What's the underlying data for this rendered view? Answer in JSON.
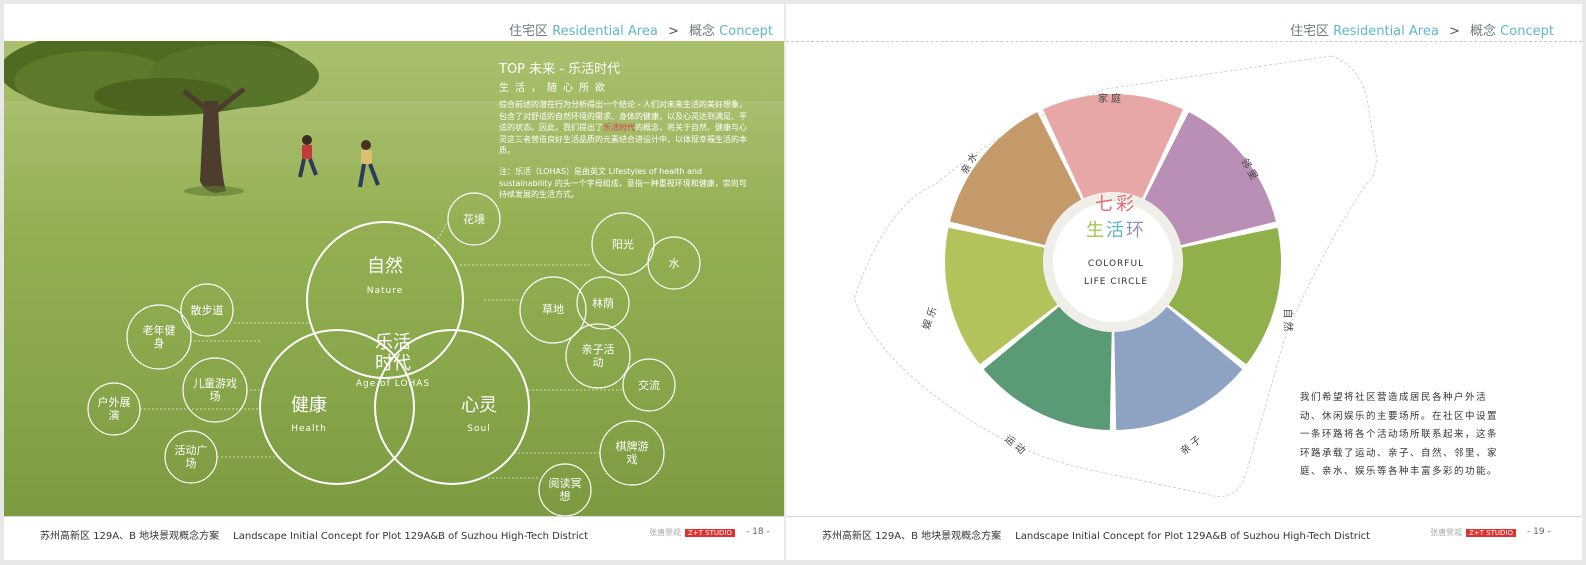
{
  "left_page": {
    "breadcrumb": {
      "zh1": "住宅区",
      "en1": "Residential Area",
      "sep": ">",
      "zh2": "概念",
      "en2": "Concept"
    },
    "overlay": {
      "title": "TOP 未来 - 乐活时代",
      "subtitle": "生活，随心所欲",
      "para1_a": "综合前述的潜在行为分析得出一个结论 - 人们对未来生活的美好想象，包含了对舒适的自然环境的需求、身体的健康，以及心灵达到满足、平适的状态。因此，我们提出了",
      "para1_hl": "乐活时代",
      "para1_b": "的概念，将关于自然、健康与心灵这三者营造良好生活品质的元素结合进设计中，以体现幸福生活的本质。",
      "para2": "注：乐活（LOHAS）是由英文 Lifestyles of health and sustainability 的头一个字母组成，意指一种重视环境和健康，崇尚可持续发展的生活方式。"
    },
    "diagram": {
      "nature_zh": "自然",
      "nature_en": "Nature",
      "health_zh": "健康",
      "health_en": "Health",
      "soul_zh": "心灵",
      "soul_en": "Soul",
      "center_zh1": "乐活",
      "center_zh2": "时代",
      "center_en": "Age of LOHAS",
      "bubbles": [
        "花境",
        "阳光",
        "水",
        "草地",
        "林荫",
        "亲子活动",
        "交流",
        "棋牌游戏",
        "阅读冥想",
        "散步道",
        "老年健身",
        "儿童游戏场",
        "户外展演",
        "活动广场"
      ]
    },
    "footer": {
      "zh": "苏州高新区 129A、B 地块景观概念方案",
      "en": "Landscape Initial Concept for Plot 129A&B of Suzhou High-Tech District",
      "studio": "张唐景观",
      "badge": "Z+T STUDIO",
      "page": "- 18 -"
    }
  },
  "right_page": {
    "breadcrumb": {
      "zh1": "住宅区",
      "en1": "Residential Area",
      "sep": ">",
      "zh2": "概念",
      "en2": "Concept"
    },
    "wheel": {
      "center_zh1": "七彩",
      "center_zh2_a": "生",
      "center_zh2_b": "活",
      "center_zh2_c": "环",
      "center_en1": "COLORFUL",
      "center_en2": "LIFE CIRCLE",
      "segments": [
        "家庭",
        "邻里",
        "自然",
        "亲子",
        "运动",
        "娱乐",
        "亲水"
      ],
      "colors": [
        "#e7a7a6",
        "#b98fb5",
        "#8fb04a",
        "#8ea3c4",
        "#5a9a74",
        "#b3c25a",
        "#c59a6a"
      ]
    },
    "description": "我们希望将社区营造成居民各种户外活动、休闲娱乐的主要场所。在社区中设置一条环路将各个活动场所联系起来，这条环路承载了运动、亲子、自然、邻里、家庭、亲水、娱乐等各种丰富多彩的功能。",
    "footer": {
      "zh": "苏州高新区 129A、B 地块景观概念方案",
      "en": "Landscape Initial Concept for Plot 129A&B of Suzhou High-Tech District",
      "studio": "张唐景观",
      "badge": "Z+T STUDIO",
      "page": "- 19 -"
    }
  }
}
